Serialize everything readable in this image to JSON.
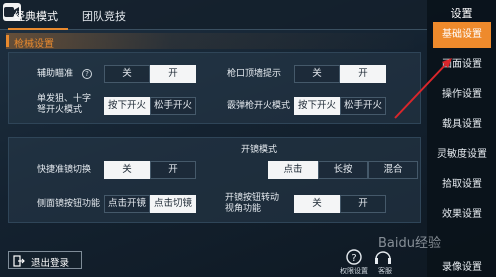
{
  "top_tabs": [
    {
      "label": "经典模式",
      "active": true
    },
    {
      "label": "团队竞技",
      "active": false
    }
  ],
  "section_title": "枪械设置",
  "settings": {
    "aim_assist": {
      "label": "辅助瞄准",
      "options": [
        "关",
        "开"
      ],
      "selected": "开"
    },
    "muzzle_hint": {
      "label": "枪口顶墙提示",
      "options": [
        "关",
        "开"
      ],
      "selected": "开"
    },
    "single_shot": {
      "label": "单发狙、十字弩开火模式",
      "options": [
        "按下开火",
        "松手开火"
      ],
      "selected": "按下开火"
    },
    "bolt_action": {
      "label": "霰弹枪开火模式",
      "options": [
        "按下开火",
        "松手开火"
      ],
      "selected": "按下开火"
    },
    "quick_scope": {
      "label": "快捷准镜切换",
      "options": [
        "关",
        "开"
      ],
      "selected": "关"
    },
    "scope_mode": {
      "label": "开镜模式",
      "options": [
        "点击",
        "长按",
        "混合"
      ],
      "selected": "点击"
    },
    "side_scope": {
      "label": "侧面镜按钮功能",
      "options": [
        "点击开镜",
        "点击切镜"
      ],
      "selected": "点击切镜"
    },
    "scope_turn": {
      "label": "开镜按钮转动视角功能",
      "options": [
        "关",
        "开"
      ],
      "selected": "关"
    }
  },
  "sidebar": {
    "title": "设置",
    "items": [
      {
        "label": "基础设置",
        "active": true
      },
      {
        "label": "画面设置",
        "active": false
      },
      {
        "label": "操作设置",
        "active": false
      },
      {
        "label": "载具设置",
        "active": false
      },
      {
        "label": "灵敏度设置",
        "active": false
      },
      {
        "label": "拾取设置",
        "active": false
      },
      {
        "label": "效果设置",
        "active": false
      },
      {
        "label": "录像设置",
        "active": false
      }
    ]
  },
  "logout_label": "退出登录",
  "bottom_buttons": [
    {
      "label": "权限设置",
      "icon": "question-icon"
    },
    {
      "label": "客服",
      "icon": "headset-icon"
    }
  ],
  "watermark": "Baidu经验",
  "colors": {
    "accent": "#ee8a2c",
    "selected_option_bg": "#f4f5f6",
    "arrow": "#d9262b"
  },
  "icons": {
    "top_left": "video-camera-icon",
    "logout": "logout-icon",
    "help": "help-circle-icon"
  }
}
